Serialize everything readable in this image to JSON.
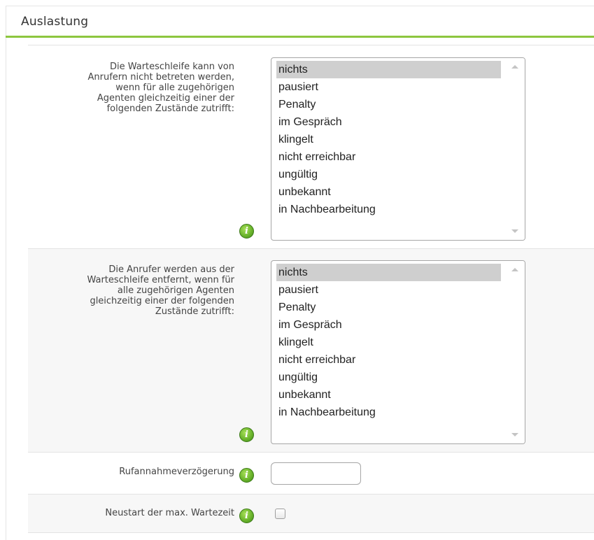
{
  "panel": {
    "title": "Auslastung"
  },
  "settings": [
    {
      "label": "Die Warteschleife kann von Anrufern nicht betreten werden, wenn für alle zugehörigen Agenten gleichzeitig einer der folgenden Zustände zutrifft:",
      "label_lines": [
        "Die Warteschleife kann von",
        "Anrufern nicht betreten werden,",
        "wenn für alle zugehörigen",
        "Agenten gleichzeitig einer der",
        "folgenden Zustände zutrifft:"
      ],
      "control": "multiselect",
      "options": [
        "nichts",
        "pausiert",
        "Penalty",
        "im Gespräch",
        "klingelt",
        "nicht erreichbar",
        "ungültig",
        "unbekannt",
        "in Nachbearbeitung"
      ],
      "selected": "nichts"
    },
    {
      "label": "Die Anrufer werden aus der Warteschleife entfernt, wenn für alle zugehörigen Agenten gleichzeitig einer der folgenden Zustände zutrifft:",
      "label_lines": [
        "Die Anrufer werden aus der",
        "Warteschleife entfernt, wenn für",
        "alle zugehörigen Agenten",
        "gleichzeitig einer der folgenden",
        "Zustände zutrifft:"
      ],
      "control": "multiselect",
      "options": [
        "nichts",
        "pausiert",
        "Penalty",
        "im Gespräch",
        "klingelt",
        "nicht erreichbar",
        "ungültig",
        "unbekannt",
        "in Nachbearbeitung"
      ],
      "selected": "nichts"
    },
    {
      "label": "Rufannahmeverzögerung",
      "control": "text",
      "value": ""
    },
    {
      "label": "Neustart der max. Wartezeit",
      "control": "checkbox",
      "checked": false
    }
  ],
  "icons": {
    "info": "info-icon",
    "info_glyph": "i"
  },
  "colors": {
    "accent": "#8dc63f",
    "info_green": "#6cb52d",
    "selected_bg": "#cfcfcf"
  }
}
